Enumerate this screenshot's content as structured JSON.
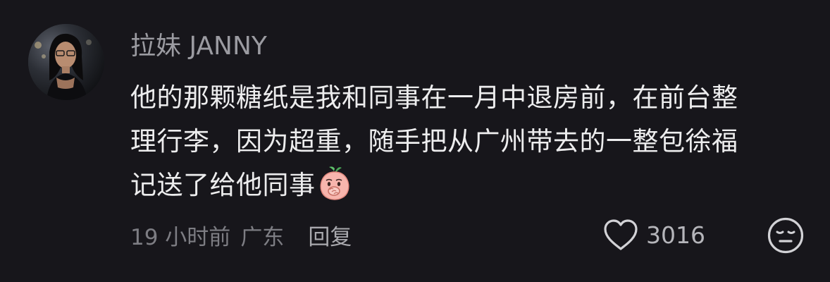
{
  "comment": {
    "author": "拉妹 JANNY",
    "text_lines": [
      "他的那颗糖纸是我和同事在一月中退房前，在前台整",
      "理行李，因为超重，随手把从广州带去的一整包徐福",
      "记送了给他同事"
    ],
    "emoji": "peach-cover-mouth-emoji",
    "time": "19 小时前",
    "location": "广东",
    "reply_label": "回复",
    "like_count": "3016",
    "like_icon": "heart-outline-icon",
    "dislike_icon": "meh-face-icon"
  },
  "colors": {
    "background": "#17161b",
    "author": "#9b9ba1",
    "body": "#ededee",
    "meta": "#7d7d83"
  }
}
